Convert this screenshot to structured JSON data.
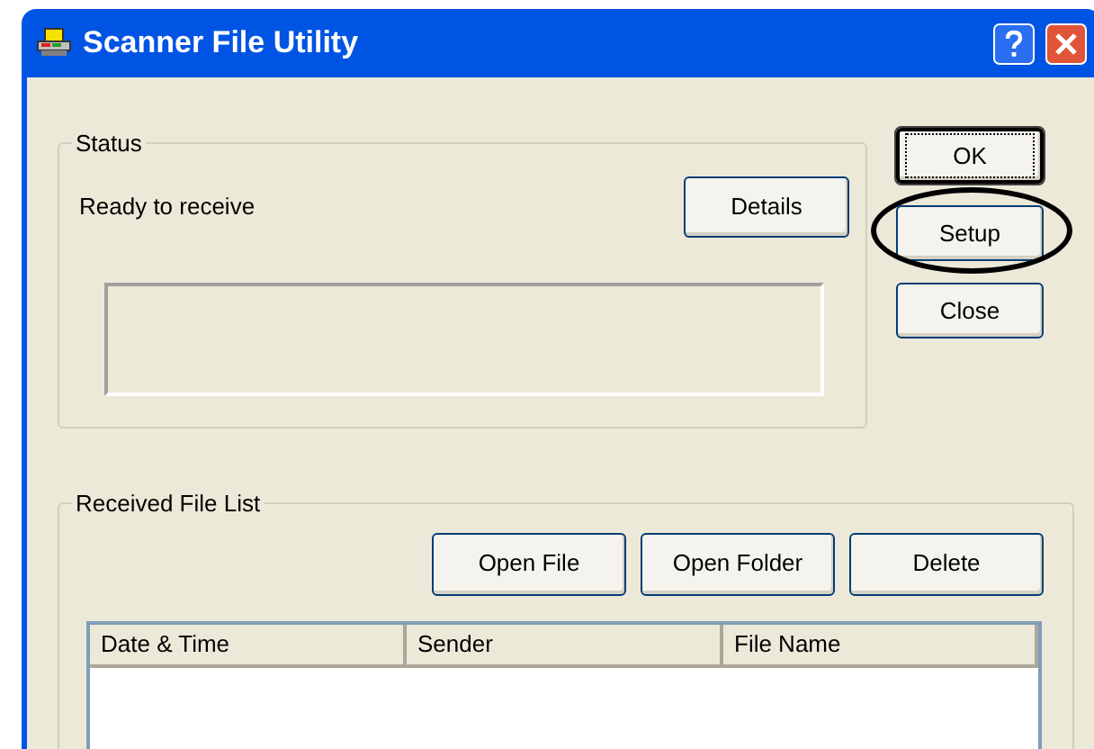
{
  "window": {
    "title": "Scanner File Utility"
  },
  "status": {
    "legend": "Status",
    "message": "Ready to receive",
    "details_button": "Details"
  },
  "side_buttons": [
    {
      "label": "OK",
      "focused": true,
      "highlighted": false
    },
    {
      "label": "Setup",
      "focused": false,
      "highlighted": true
    },
    {
      "label": "Close",
      "focused": false,
      "highlighted": false
    }
  ],
  "received": {
    "legend": "Received File List",
    "buttons": [
      "Open File",
      "Open Folder",
      "Delete"
    ],
    "table": {
      "columns": [
        "Date & Time",
        "Sender",
        "File Name"
      ]
    }
  }
}
